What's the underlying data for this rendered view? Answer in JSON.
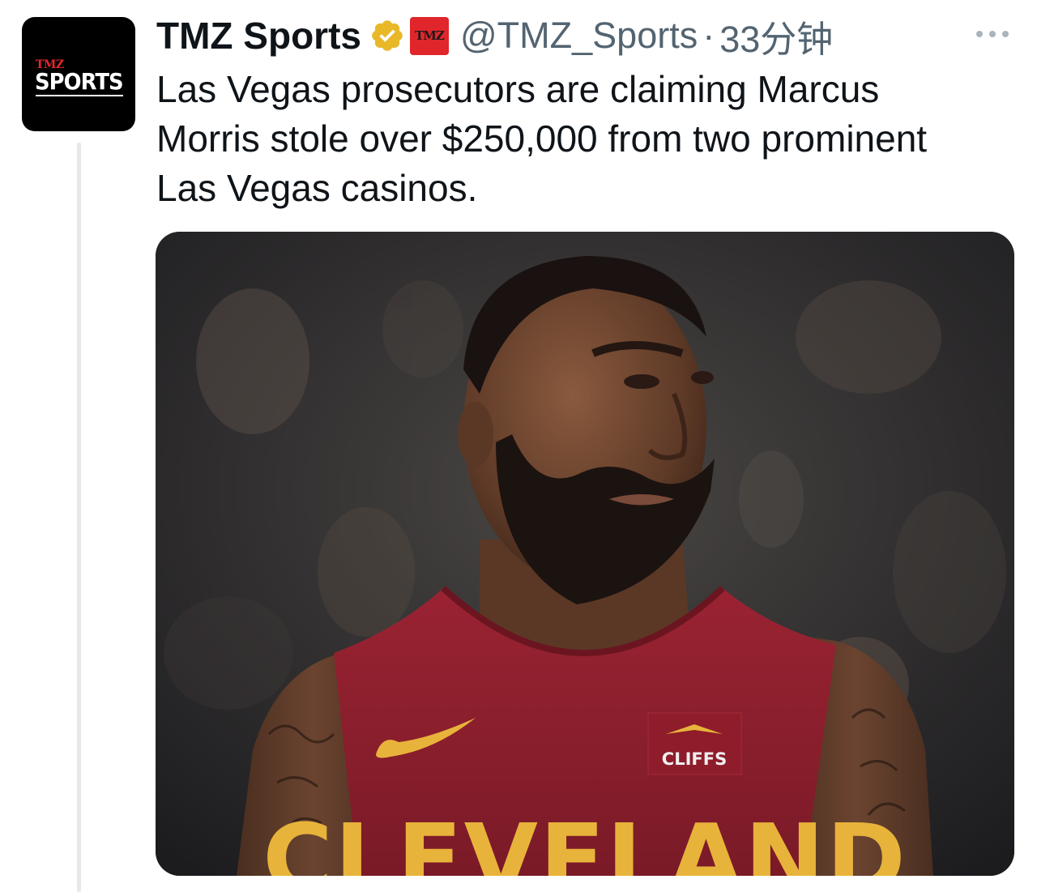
{
  "author": {
    "display_name": "TMZ Sports",
    "handle": "@TMZ_Sports",
    "timestamp": "33分钟",
    "avatar": {
      "brand_small": "TMZ",
      "brand_large": "SPORTS"
    },
    "affiliate_badge": "TMZ",
    "verified_color": "#e8b829"
  },
  "tweet": {
    "text_line_1": "Las Vegas prosecutors are claiming Marcus",
    "text_line_2": "Morris stole over $250,000 from two prominent",
    "text_line_3": "Las Vegas casinos."
  },
  "media": {
    "jersey_text": "CLEVELAND",
    "sponsor_text": "CLIFFS",
    "jersey_color": "#8b1d2c",
    "accent_color": "#e8b33a"
  },
  "colors": {
    "text_primary": "#0f1419",
    "text_secondary": "#536471",
    "brand_red": "#e0262b"
  }
}
